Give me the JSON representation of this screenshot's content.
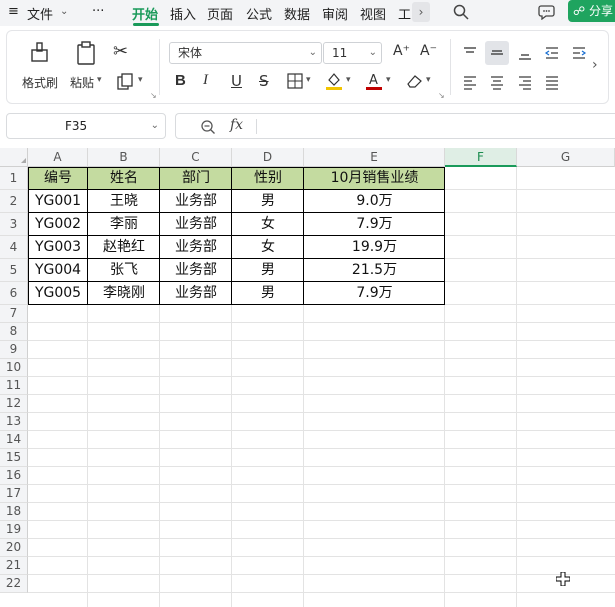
{
  "menubar": {
    "menu_icon": "≡",
    "file_label": "文件",
    "more_label": "···",
    "tabs": [
      "开始",
      "插入",
      "页面",
      "公式",
      "数据",
      "审阅",
      "视图",
      "工"
    ],
    "active_tab": "开始",
    "share_label": "分享"
  },
  "ribbon": {
    "format_painter_label": "格式刷",
    "paste_label": "粘贴",
    "font_name": "宋体",
    "font_size": "11",
    "bold": "B",
    "italic": "I",
    "underline": "U",
    "strike": "S",
    "font_color_accent": "#c00000",
    "fill_color_accent": "#f2c400"
  },
  "formula_bar": {
    "cell_ref": "F35",
    "fx_label": "fx",
    "formula": ""
  },
  "grid": {
    "columns": [
      "A",
      "B",
      "C",
      "D",
      "E",
      "F",
      "G"
    ],
    "selected_column": "F",
    "rows": [
      "1",
      "2",
      "3",
      "4",
      "5",
      "6",
      "7",
      "8",
      "9",
      "10",
      "11",
      "12",
      "13",
      "14",
      "15",
      "16",
      "17",
      "18",
      "19",
      "20",
      "21",
      "22"
    ],
    "header_fill": "#c4dba0",
    "table_headers": [
      "编号",
      "姓名",
      "部门",
      "性别",
      "10月销售业绩"
    ],
    "table_rows": [
      [
        "YG001",
        "王晓",
        "业务部",
        "男",
        "9.0万"
      ],
      [
        "YG002",
        "李丽",
        "业务部",
        "女",
        "7.9万"
      ],
      [
        "YG003",
        "赵艳红",
        "业务部",
        "女",
        "19.9万"
      ],
      [
        "YG004",
        "张飞",
        "业务部",
        "男",
        "21.5万"
      ],
      [
        "YG005",
        "李晓刚",
        "业务部",
        "男",
        "7.9万"
      ]
    ]
  }
}
